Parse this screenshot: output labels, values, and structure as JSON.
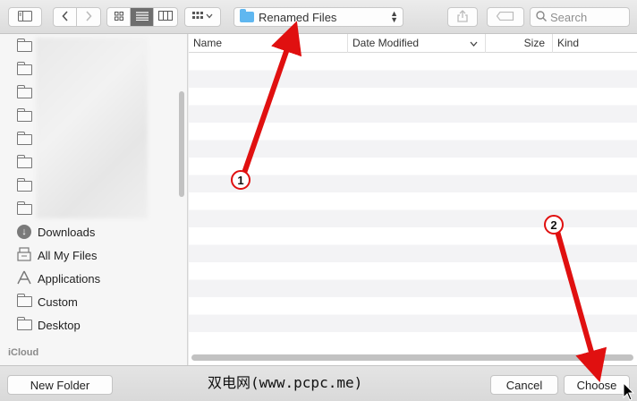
{
  "toolbar": {
    "path_popup_label": "Renamed Files",
    "search_placeholder": "Search"
  },
  "sidebar": {
    "favorites": [
      {
        "label": "Downloads",
        "icon": "download-icon"
      },
      {
        "label": "All My Files",
        "icon": "all-files-icon"
      },
      {
        "label": "Applications",
        "icon": "applications-icon"
      },
      {
        "label": "Custom",
        "icon": "folder-icon"
      },
      {
        "label": "Desktop",
        "icon": "folder-icon"
      }
    ],
    "section_icloud": "iCloud"
  },
  "file_list": {
    "columns": [
      "Name",
      "Date Modified",
      "Size",
      "Kind"
    ],
    "sort_indicator": "chevron-down-icon"
  },
  "bottom": {
    "new_folder_label": "New Folder",
    "cancel_label": "Cancel",
    "choose_label": "Choose",
    "watermark": "双电网(www.pcpc.me)"
  },
  "annotations": [
    {
      "number": "1"
    },
    {
      "number": "2"
    }
  ],
  "colors": {
    "annotation_red": "#e01010",
    "folder_blue": "#5fb7f0"
  }
}
